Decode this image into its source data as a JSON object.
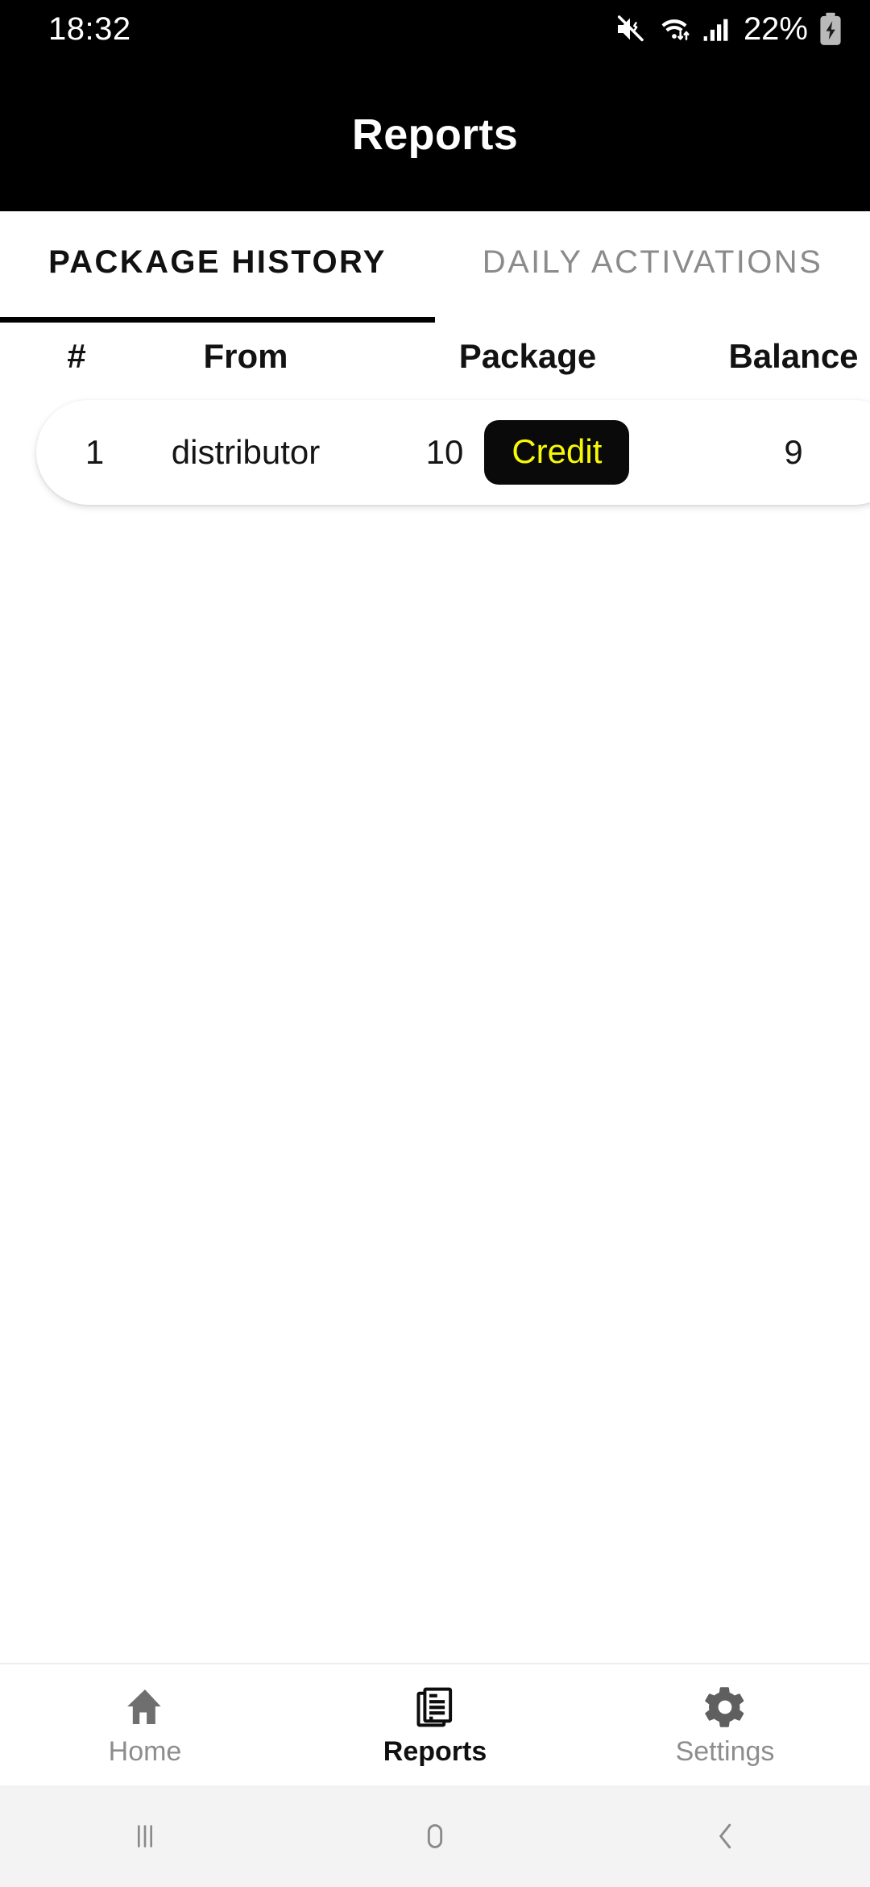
{
  "status_bar": {
    "time": "18:32",
    "battery_percent": "22%",
    "icons": [
      "mute-vibrate-icon",
      "wifi-data-icon",
      "cellular-signal-icon",
      "battery-charging-icon"
    ]
  },
  "app_bar": {
    "title": "Reports",
    "background": "#000000",
    "text_color": "#ffffff"
  },
  "tabs": [
    {
      "label": "PACKAGE HISTORY",
      "active": true
    },
    {
      "label": "DAILY ACTIVATIONS",
      "active": false
    }
  ],
  "table": {
    "headers": [
      "#",
      "From",
      "Package",
      "Balance"
    ],
    "rows": [
      {
        "num": "1",
        "from": "distributor",
        "package_amount": "10",
        "package_type": "Credit",
        "balance": "9"
      }
    ]
  },
  "theme": {
    "accent_yellow": "#f9f906",
    "pill_background": "#0a0a0a",
    "active_tab_indicator": "#000000",
    "inactive_text": "#8b8b8b"
  },
  "bottom_nav": [
    {
      "label": "Home",
      "icon": "home-icon",
      "active": false
    },
    {
      "label": "Reports",
      "icon": "document-report-icon",
      "active": true
    },
    {
      "label": "Settings",
      "icon": "gear-icon",
      "active": false
    }
  ],
  "system_nav": [
    {
      "name": "recents-button",
      "icon": "recents-icon"
    },
    {
      "name": "home-button",
      "icon": "home-pill-icon"
    },
    {
      "name": "back-button",
      "icon": "chevron-left-icon"
    }
  ]
}
